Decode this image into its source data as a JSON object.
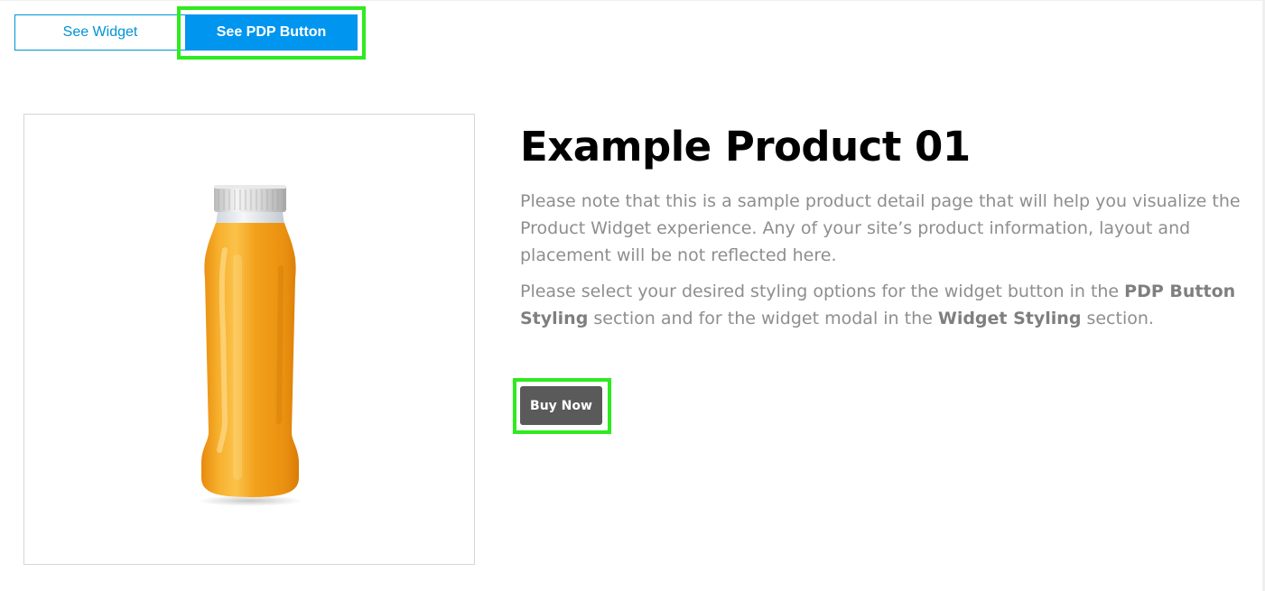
{
  "tabs": {
    "widget_label": "See Widget",
    "pdp_label": "See PDP Button",
    "active": "See PDP Button"
  },
  "product": {
    "title": "Example Product 01",
    "image_icon": "juice-bottle-icon",
    "description_1": "Please note that this is a sample product detail page that will help you visualize the Product Widget experience. Any of your site’s product information, layout and placement will be not reflected here.",
    "description_2": {
      "part_1": "Please select your desired styling options for the widget button in the ",
      "bold_1": "PDP Button Styling",
      "part_2": " section and for the widget modal in the ",
      "bold_2": "Widget Styling",
      "part_3": " section."
    },
    "buy_label": "Buy Now"
  },
  "colors": {
    "accent_blue": "#0095ef",
    "highlight_green": "#2eeb1e",
    "buy_button": "#5a5a5a",
    "bottle_orange": "#f0a11c"
  }
}
